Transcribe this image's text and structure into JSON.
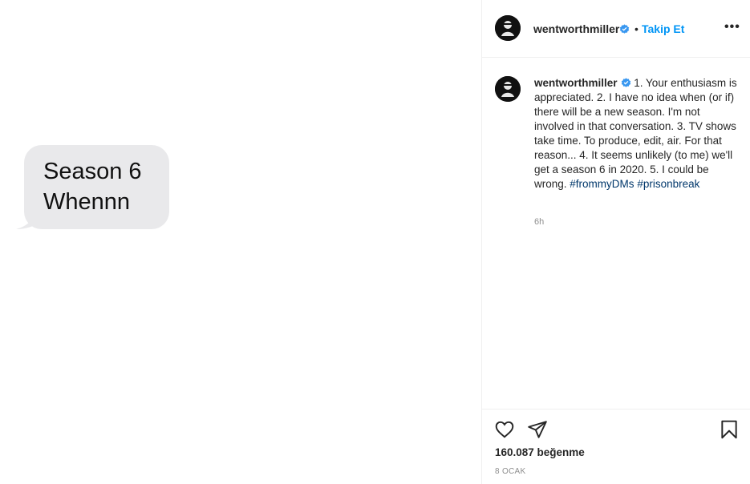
{
  "media": {
    "bubble_line1": "Season 6",
    "bubble_line2": "Whennn"
  },
  "header": {
    "username": "wentworthmiller",
    "verified_icon": "verified-badge-icon",
    "separator": "•",
    "follow_label": "Takip Et",
    "more_label": "•••"
  },
  "caption": {
    "username": "wentworthmiller",
    "text": "1. Your enthusiasm is appreciated. 2. I have no idea when (or if) there will be a new season. I'm not involved in that conversation. 3. TV shows take time. To produce, edit, air. For that reason... 4. It seems unlikely (to me) we'll get a season 6 in 2020. 5. I could be wrong.",
    "hashtag1": "#frommyDMs",
    "hashtag2": "#prisonbreak",
    "time": "6h"
  },
  "actions": {
    "like_icon": "heart-icon",
    "share_icon": "paper-plane-icon",
    "save_icon": "bookmark-icon",
    "likes_text": "160.087 beğenme",
    "date_text": "8 OCAK"
  },
  "colors": {
    "accent": "#0095f6",
    "hashtag": "#00376b",
    "bubble": "#e9e9eb"
  }
}
